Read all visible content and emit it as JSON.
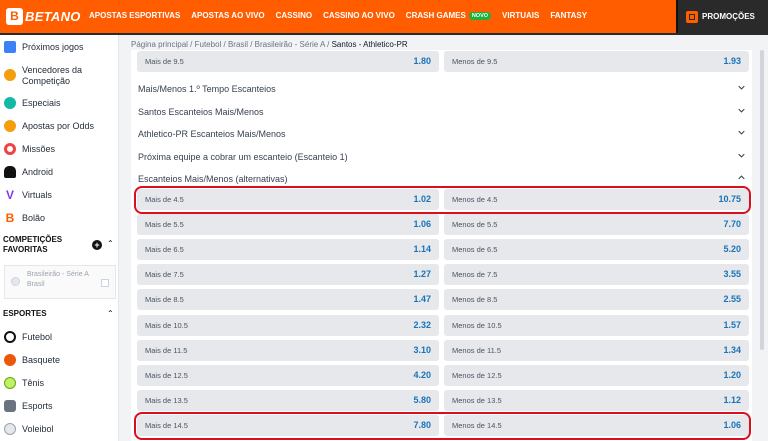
{
  "header": {
    "logo_text": "BETANO",
    "logo_letter": "B",
    "nav": [
      {
        "label": "APOSTAS ESPORTIVAS"
      },
      {
        "label": "APOSTAS AO VIVO"
      },
      {
        "label": "CASSINO"
      },
      {
        "label": "CASSINO AO VIVO"
      },
      {
        "label": "CRASH GAMES",
        "badge": "NOVO"
      },
      {
        "label": "VIRTUAIS"
      },
      {
        "label": "FANTASY"
      }
    ],
    "promocoes": "PROMOÇÕES"
  },
  "sidebar": {
    "items": [
      {
        "label": "Próximos jogos",
        "icon": "calendar-icon",
        "color": "#3b82f6"
      },
      {
        "label": "Vencedores da Competição",
        "icon": "trophy-icon",
        "color": "#f59e0b"
      },
      {
        "label": "Especiais",
        "icon": "star-icon",
        "color": "#14b8a6"
      },
      {
        "label": "Apostas por Odds",
        "icon": "medal-icon",
        "color": "#f59e0b"
      },
      {
        "label": "Missões",
        "icon": "target-icon",
        "color": "#ef4444"
      },
      {
        "label": "Android",
        "icon": "android-icon",
        "color": "#111111"
      },
      {
        "label": "Virtuals",
        "icon": "virtuals-icon",
        "color": "#7c3aed"
      },
      {
        "label": "Bolão",
        "icon": "bolao-icon",
        "color": "#ff5d00"
      }
    ],
    "favorites_title": "COMPETIÇÕES FAVORITAS",
    "favorite": {
      "name": "Brasileirão - Série A",
      "country": "Brasil"
    },
    "sports_title": "ESPORTES",
    "sports": [
      {
        "label": "Futebol",
        "icon": "soccer-ball-icon",
        "color": "#111111"
      },
      {
        "label": "Basquete",
        "icon": "basketball-icon",
        "color": "#ea580c"
      },
      {
        "label": "Tênis",
        "icon": "tennis-ball-icon",
        "color": "#a3e635"
      },
      {
        "label": "Esports",
        "icon": "gamepad-icon",
        "color": "#6b7280"
      },
      {
        "label": "Voleibol",
        "icon": "volleyball-icon",
        "color": "#9ca3af"
      }
    ]
  },
  "breadcrumb": {
    "items": [
      "Página principal",
      "Futebol",
      "Brasil",
      "Brasileirão - Série A"
    ],
    "separator": " / ",
    "current": "Santos - Athletico-PR"
  },
  "top_row": {
    "left_label": "Mais de 9.5",
    "left_value": "1.80",
    "right_label": "Menos de 9.5",
    "right_value": "1.93"
  },
  "accordions": [
    {
      "label": "Mais/Menos 1.º Tempo Escanteios"
    },
    {
      "label": "Santos Escanteios Mais/Menos"
    },
    {
      "label": "Athletico-PR Escanteios Mais/Menos"
    },
    {
      "label": "Próxima equipe a cobrar um escanteio (Escanteio 1)"
    }
  ],
  "expanded_market": {
    "label": "Escanteios Mais/Menos (alternativas)",
    "rows": [
      {
        "over_label": "Mais de 4.5",
        "over_odd": "1.02",
        "under_label": "Menos de 4.5",
        "under_odd": "10.75"
      },
      {
        "over_label": "Mais de 5.5",
        "over_odd": "1.06",
        "under_label": "Menos de 5.5",
        "under_odd": "7.70"
      },
      {
        "over_label": "Mais de 6.5",
        "over_odd": "1.14",
        "under_label": "Menos de 6.5",
        "under_odd": "5.20"
      },
      {
        "over_label": "Mais de 7.5",
        "over_odd": "1.27",
        "under_label": "Menos de 7.5",
        "under_odd": "3.55"
      },
      {
        "over_label": "Mais de 8.5",
        "over_odd": "1.47",
        "under_label": "Menos de 8.5",
        "under_odd": "2.55"
      },
      {
        "over_label": "Mais de 10.5",
        "over_odd": "2.32",
        "under_label": "Menos de 10.5",
        "under_odd": "1.57"
      },
      {
        "over_label": "Mais de 11.5",
        "over_odd": "3.10",
        "under_label": "Menos de 11.5",
        "under_odd": "1.34"
      },
      {
        "over_label": "Mais de 12.5",
        "over_odd": "4.20",
        "under_label": "Menos de 12.5",
        "under_odd": "1.20"
      },
      {
        "over_label": "Mais de 13.5",
        "over_odd": "5.80",
        "under_label": "Menos de 13.5",
        "under_odd": "1.12"
      },
      {
        "over_label": "Mais de 14.5",
        "over_odd": "7.80",
        "under_label": "Menos de 14.5",
        "under_odd": "1.06"
      }
    ]
  },
  "colors": {
    "brand": "#ff5d00",
    "odd_value": "#1a73b8",
    "highlight": "#d90f1f",
    "header_dark": "#2a2a2a"
  }
}
